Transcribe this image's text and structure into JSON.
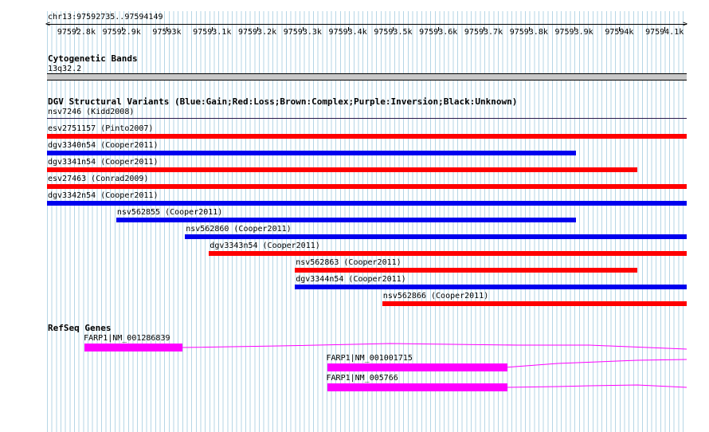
{
  "ruler": {
    "location": "chr13:97592735..97594149",
    "ticks": [
      "97592.8k",
      "97592.9k",
      "97593k",
      "97593.1k",
      "97593.2k",
      "97593.3k",
      "97593.4k",
      "97593.5k",
      "97593.6k",
      "97593.7k",
      "97593.8k",
      "97593.9k",
      "97594k",
      "97594.1k"
    ]
  },
  "cytoband": {
    "title": "Cytogenetic Bands",
    "band": "13q32.2"
  },
  "dgv": {
    "title": "DGV Structural Variants (Blue:Gain;Red:Loss;Brown:Complex;Purple:Inversion;Black:Unknown)",
    "header_variant": "nsv7246 (Kidd2008)",
    "colors": {
      "gain": "#0000ee",
      "loss": "#ff0000"
    },
    "variants": [
      {
        "label": "esv2751157 (Pinto2007)",
        "type": "loss",
        "start": 97592735,
        "end": 97594149
      },
      {
        "label": "dgv3340n54 (Cooper2011)",
        "type": "gain",
        "start": 97592735,
        "end": 97593905
      },
      {
        "label": "dgv3341n54 (Cooper2011)",
        "type": "loss",
        "start": 97592735,
        "end": 97594040
      },
      {
        "label": "esv27463 (Conrad2009)",
        "type": "loss",
        "start": 97592735,
        "end": 97594149
      },
      {
        "label": "dgv3342n54 (Cooper2011)",
        "type": "gain",
        "start": 97592735,
        "end": 97594149
      },
      {
        "label": "nsv562855 (Cooper2011)",
        "type": "gain",
        "start": 97592888,
        "end": 97593905
      },
      {
        "label": "nsv562860 (Cooper2011)",
        "type": "gain",
        "start": 97593040,
        "end": 97594149
      },
      {
        "label": "dgv3343n54 (Cooper2011)",
        "type": "loss",
        "start": 97593093,
        "end": 97594149
      },
      {
        "label": "nsv562863 (Cooper2011)",
        "type": "loss",
        "start": 97593283,
        "end": 97594040
      },
      {
        "label": "dgv3344n54 (Cooper2011)",
        "type": "gain",
        "start": 97593283,
        "end": 97594149
      },
      {
        "label": "nsv562866 (Cooper2011)",
        "type": "loss",
        "start": 97593476,
        "end": 97594149
      }
    ]
  },
  "refseq": {
    "title": "RefSeq Genes",
    "color": "#ff00ff",
    "genes": [
      {
        "label": "FARP1|NM_001286839",
        "exon_start": 97592818,
        "exon_end": 97593035
      },
      {
        "label": "FARP1|NM_001001715",
        "exon_start": 97593354,
        "exon_end": 97593752
      },
      {
        "label": "FARP1|NM_005766",
        "exon_start": 97593354,
        "exon_end": 97593752
      }
    ]
  }
}
